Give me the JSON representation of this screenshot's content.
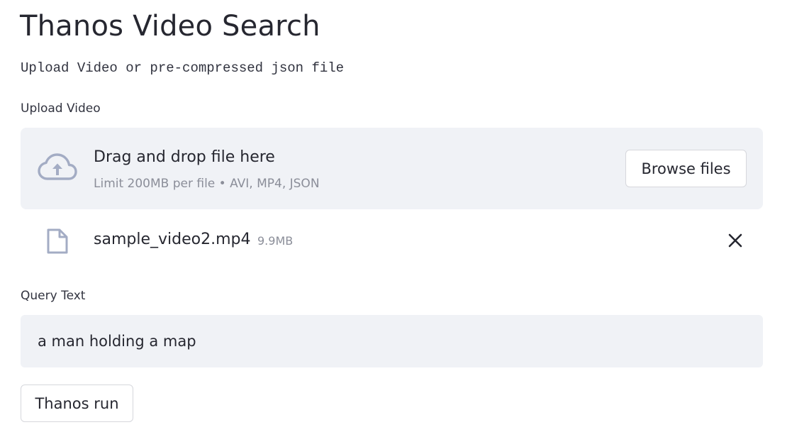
{
  "page": {
    "title": "Thanos Video Search",
    "subtitle": "Upload Video or pre-compressed json file"
  },
  "uploader": {
    "label": "Upload Video",
    "drop_text": "Drag and drop file here",
    "limit_text": "Limit 200MB per file • AVI, MP4, JSON",
    "browse_label": "Browse files",
    "icon": "cloud-upload-icon"
  },
  "uploaded_file": {
    "name": "sample_video2.mp4",
    "size": "9.9MB",
    "icon": "file-icon",
    "remove_icon": "close-icon"
  },
  "query": {
    "label": "Query Text",
    "value": "a man holding a map"
  },
  "actions": {
    "run_label": "Thanos run"
  },
  "colors": {
    "background": "#ffffff",
    "input_background": "#f0f2f6",
    "text": "#262730",
    "muted_text": "#8b8e99",
    "icon": "#a3acc4",
    "border": "#d6d7dc"
  }
}
